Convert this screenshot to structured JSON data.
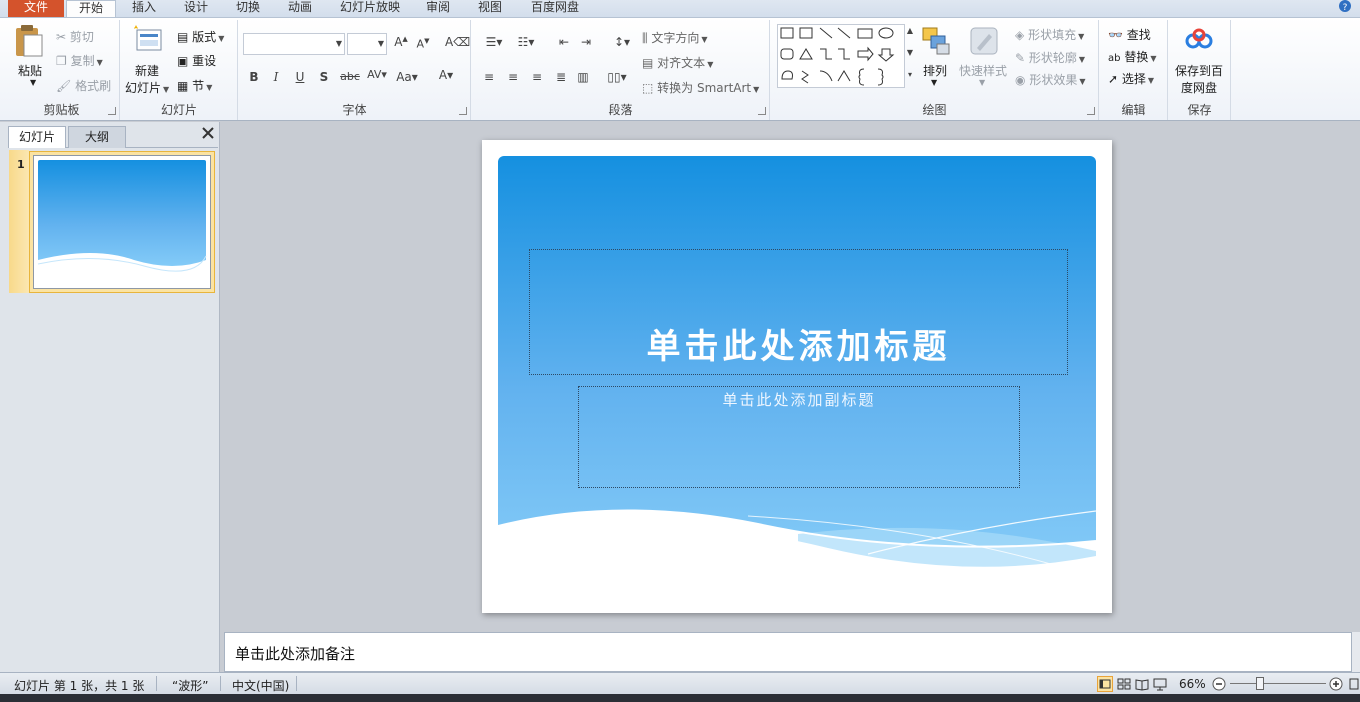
{
  "tabs": [
    {
      "label": "文件",
      "type": "file"
    },
    {
      "label": "开始",
      "type": "active"
    },
    {
      "label": "插入"
    },
    {
      "label": "设计"
    },
    {
      "label": "切换"
    },
    {
      "label": "动画"
    },
    {
      "label": "幻灯片放映"
    },
    {
      "label": "审阅"
    },
    {
      "label": "视图"
    },
    {
      "label": "百度网盘"
    }
  ],
  "clipboard": {
    "label": "剪贴板",
    "paste": "粘贴",
    "cut": "剪切",
    "copy": "复制",
    "format_painter": "格式刷"
  },
  "slides_group": {
    "label": "幻灯片",
    "new_line1": "新建",
    "new_line2": "幻灯片",
    "layout": "版式",
    "reset": "重设",
    "section": "节"
  },
  "font": {
    "label": "字体",
    "font_name": "",
    "font_size": ""
  },
  "paragraph": {
    "label": "段落",
    "text_direction": "文字方向",
    "align_text": "对齐文本",
    "smartart": "转换为 SmartArt"
  },
  "drawing": {
    "label": "绘图",
    "arrange": "排列",
    "quick_styles": "快速样式",
    "shape_fill": "形状填充",
    "shape_outline": "形状轮廓",
    "shape_effects": "形状效果"
  },
  "editing": {
    "label": "编辑",
    "find": "查找",
    "replace": "替换",
    "select": "选择"
  },
  "save": {
    "label": "保存",
    "line1": "保存到百",
    "line2": "度网盘"
  },
  "panel": {
    "tab_slides": "幻灯片",
    "tab_outline": "大纲",
    "thumb_number": "1"
  },
  "slide": {
    "title": "单击此处添加标题",
    "subtitle": "单击此处添加副标题"
  },
  "notes": {
    "placeholder": "单击此处添加备注"
  },
  "status": {
    "slide_info": "幻灯片 第 1 张，共 1 张",
    "theme": "“波形”",
    "language": "中文(中国)",
    "zoom": "66%"
  },
  "colors": {
    "file_tab": "#d4532c",
    "slide_top": "#1590e0",
    "slide_mid": "#62b2ef",
    "slide_bottom": "#87cdf8",
    "thumb_border": "#e8b53c"
  }
}
